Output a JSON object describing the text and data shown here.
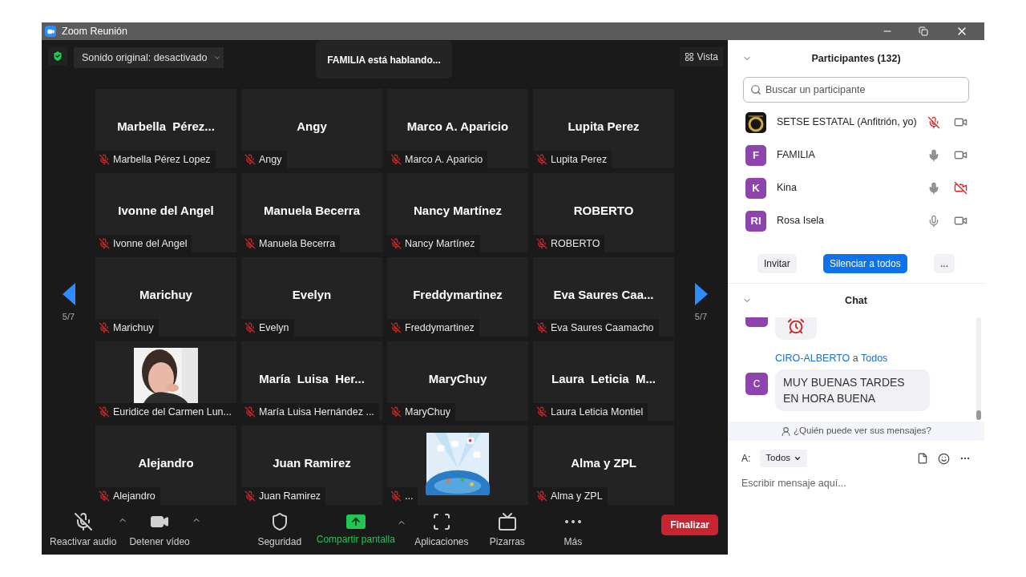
{
  "window": {
    "title": "Zoom Reunión"
  },
  "top_bar": {
    "audio_menu": "Sonido original: desactivado",
    "speaker_notice": "FAMILIA está hablando...",
    "view_button": "Vista"
  },
  "pager": {
    "left": "5/7",
    "right": "5/7"
  },
  "tiles": [
    {
      "kind": "name",
      "display_name": "Marbella  Pérez...",
      "label": "Marbella Pérez Lopez",
      "muted": true
    },
    {
      "kind": "name",
      "display_name": "Angy",
      "label": "Angy",
      "muted": true
    },
    {
      "kind": "name",
      "display_name": "Marco A. Aparicio",
      "label": "Marco A. Aparicio",
      "muted": true
    },
    {
      "kind": "name",
      "display_name": "Lupita Perez",
      "label": "Lupita Perez",
      "muted": true
    },
    {
      "kind": "name",
      "display_name": "Ivonne del Angel",
      "label": "Ivonne del Angel",
      "muted": true
    },
    {
      "kind": "name",
      "display_name": "Manuela Becerra",
      "label": "Manuela Becerra",
      "muted": true
    },
    {
      "kind": "name",
      "display_name": "Nancy Martínez",
      "label": "Nancy Martínez",
      "muted": true
    },
    {
      "kind": "name",
      "display_name": "ROBERTO",
      "label": "ROBERTO",
      "muted": true
    },
    {
      "kind": "name",
      "display_name": "Marichuy",
      "label": "Marichuy",
      "muted": true
    },
    {
      "kind": "name",
      "display_name": "Evelyn",
      "label": "Evelyn",
      "muted": true
    },
    {
      "kind": "name",
      "display_name": "Freddymartinez",
      "label": "Freddymartinez",
      "muted": true
    },
    {
      "kind": "name",
      "display_name": "Eva Saures Caa...",
      "label": "Eva Saures Caamacho",
      "muted": true
    },
    {
      "kind": "picture",
      "label": "Euridice del Carmen Lun...",
      "muted": true
    },
    {
      "kind": "name",
      "display_name": "María  Luisa  Her...",
      "label": "María Luisa Hernández ...",
      "muted": true
    },
    {
      "kind": "name",
      "display_name": "MaryChuy",
      "label": "MaryChuy",
      "muted": true
    },
    {
      "kind": "name",
      "display_name": "Laura  Leticia  M...",
      "label": "Laura Leticia Montiel",
      "muted": true
    },
    {
      "kind": "name",
      "display_name": "Alejandro",
      "label": "Alejandro",
      "muted": true
    },
    {
      "kind": "name",
      "display_name": "Juan Ramirez",
      "label": "Juan Ramirez",
      "muted": true
    },
    {
      "kind": "graphic",
      "label": "...",
      "muted": true
    },
    {
      "kind": "name",
      "display_name": "Alma y ZPL",
      "label": "Alma y ZPL",
      "muted": true
    }
  ],
  "toolbar": [
    {
      "kind": "audio",
      "label": "Reactivar audio",
      "caret": true,
      "muted": true
    },
    {
      "kind": "video",
      "label": "Detener vídeo",
      "caret": true
    },
    {
      "kind": "security",
      "label": "Seguridad",
      "caret": false
    },
    {
      "kind": "share",
      "label": "Compartir pantalla",
      "caret": true
    },
    {
      "kind": "apps",
      "label": "Aplicaciones",
      "caret": false
    },
    {
      "kind": "whiteboard",
      "label": "Pizarras",
      "caret": false
    },
    {
      "kind": "more",
      "label": "Más",
      "caret": false
    }
  ],
  "end_button": "Finalizar",
  "participants": {
    "title": "Participantes (132)",
    "search_placeholder": "Buscar un participante",
    "items": [
      {
        "kind": "picture",
        "name": "SETSE ESTATAL (Anfitrión, yo)",
        "muted": true,
        "video_on": true
      },
      {
        "kind": "initials",
        "initials": "F",
        "name": "FAMILIA",
        "muted": false,
        "speaking": true,
        "video_on": true
      },
      {
        "kind": "initials",
        "initials": "K",
        "name": "Kina",
        "muted": false,
        "speaking": true,
        "video_on": false
      },
      {
        "kind": "initials",
        "initials": "RI",
        "name": "Rosa Isela",
        "muted": false,
        "speaking": false,
        "video_on": true
      }
    ],
    "buttons": [
      "Invitar",
      "Silenciar a todos",
      "..."
    ]
  },
  "chat": {
    "title": "Chat",
    "messages": [
      {
        "kind": "emoji"
      },
      {
        "kind": "text",
        "sender": "CIRO-ALBERTO",
        "connector": "a",
        "recipient": "Todos",
        "initial": "C",
        "text": "MUY BUENAS TARDES EN HORA BUENA"
      }
    ],
    "privacy_note": "¿Quién puede ver sus mensajes?",
    "to_label": "A:",
    "to_value": "Todos",
    "input_placeholder": "Escribir mensaje aquí..."
  }
}
